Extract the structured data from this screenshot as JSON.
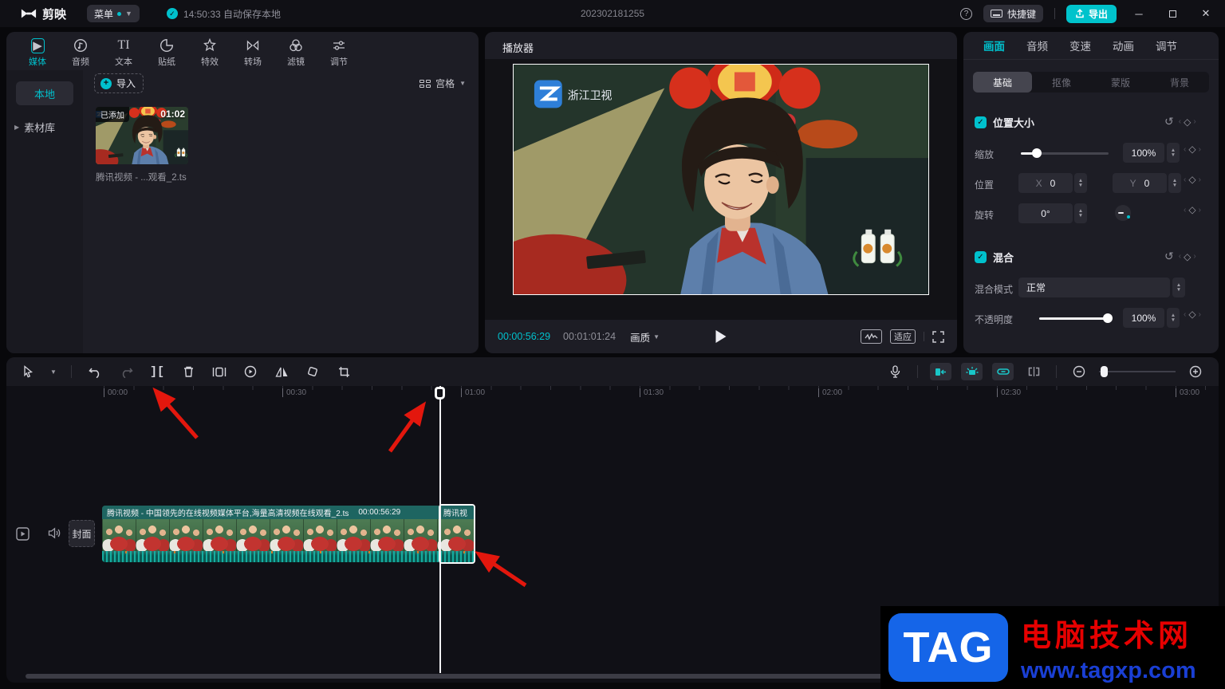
{
  "colors": {
    "accent": "#00c1cd",
    "arrow_red": "#e3170d",
    "clip_header_teal": "#1e6561",
    "waveform_teal": "#0b5a53",
    "tag_blue": "#1565e8",
    "tag_red": "#e60000",
    "tag_url_blue": "#1a3fd4"
  },
  "titlebar": {
    "app_name": "剪映",
    "menu_label": "菜单",
    "autosave_text": "14:50:33 自动保存本地",
    "project_id": "202302181255",
    "shortcuts_label": "快捷键",
    "export_label": "导出"
  },
  "media_panel": {
    "tabs": [
      "媒体",
      "音频",
      "文本",
      "贴纸",
      "特效",
      "转场",
      "滤镜",
      "调节"
    ],
    "sidebar": {
      "local": "本地",
      "library": "素材库"
    },
    "import_label": "导入",
    "view_mode": "宫格",
    "clip": {
      "added_badge": "已添加",
      "duration": "01:02",
      "filename": "腾讯视频 - ...观看_2.ts"
    }
  },
  "player": {
    "title": "播放器",
    "channel_logo": "浙江卫视",
    "current_time": "00:00:56:29",
    "total_time": "00:01:01:24",
    "quality_label": "画质",
    "fit_label": "适应"
  },
  "props": {
    "tabs": [
      "画面",
      "音频",
      "变速",
      "动画",
      "调节"
    ],
    "subtabs": [
      "基础",
      "抠像",
      "蒙版",
      "背景"
    ],
    "position": {
      "title": "位置大小",
      "scale_label": "缩放",
      "scale_value": "100%",
      "position_label": "位置",
      "x_label": "X",
      "x_value": "0",
      "y_label": "Y",
      "y_value": "0",
      "rotate_label": "旋转",
      "rotate_value": "0°"
    },
    "blend": {
      "title": "混合",
      "mode_label": "混合模式",
      "mode_value": "正常",
      "opacity_label": "不透明度",
      "opacity_value": "100%"
    }
  },
  "timeline": {
    "ruler_labels": [
      "00:00",
      "00:30",
      "01:00",
      "01:30",
      "02:00",
      "02:30",
      "03:00"
    ],
    "cover_label": "封面",
    "clip1_title": "腾讯视频 - 中国领先的在线视频媒体平台,海量高清视频在线观看_2.ts",
    "clip1_duration": "00:00:56:29",
    "clip2_title": "腾讯视"
  },
  "watermark": {
    "logo": "TAG",
    "site_name": "电脑技术网",
    "site_url": "www.tagxp.com"
  }
}
